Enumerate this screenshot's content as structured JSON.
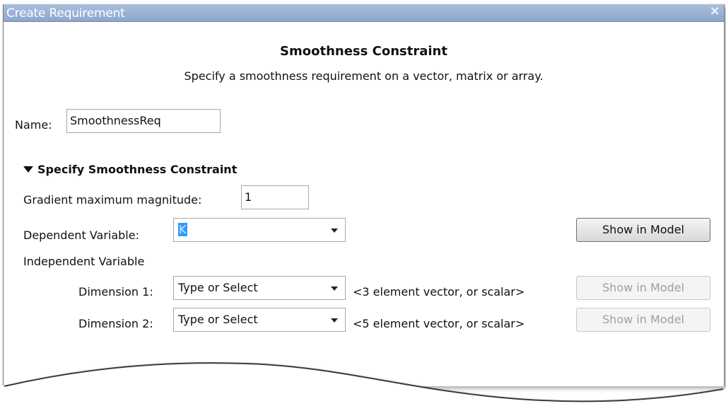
{
  "window": {
    "title": "Create Requirement",
    "close_glyph": "✕"
  },
  "header": {
    "title": "Smoothness Constraint",
    "description": "Specify a smoothness requirement on a vector, matrix or array."
  },
  "name": {
    "label": "Name:",
    "value": "SmoothnessReq"
  },
  "section": {
    "title": "Specify Smoothness Constraint",
    "expanded": true,
    "gradient": {
      "label": "Gradient maximum magnitude:",
      "value": "1"
    },
    "dependent": {
      "label": "Dependent Variable:",
      "value": "K",
      "button": "Show in Model"
    },
    "independent": {
      "label": "Independent Variable",
      "dimensions": [
        {
          "label": "Dimension 1:",
          "value": "Type or Select",
          "hint": "<3 element vector, or scalar>",
          "button": "Show in Model"
        },
        {
          "label": "Dimension 2:",
          "value": "Type or Select",
          "hint": "<5 element vector, or scalar>",
          "button": "Show in Model"
        }
      ]
    }
  },
  "colors": {
    "titlebar": "#9db3d6",
    "selection": "#3399ff"
  }
}
